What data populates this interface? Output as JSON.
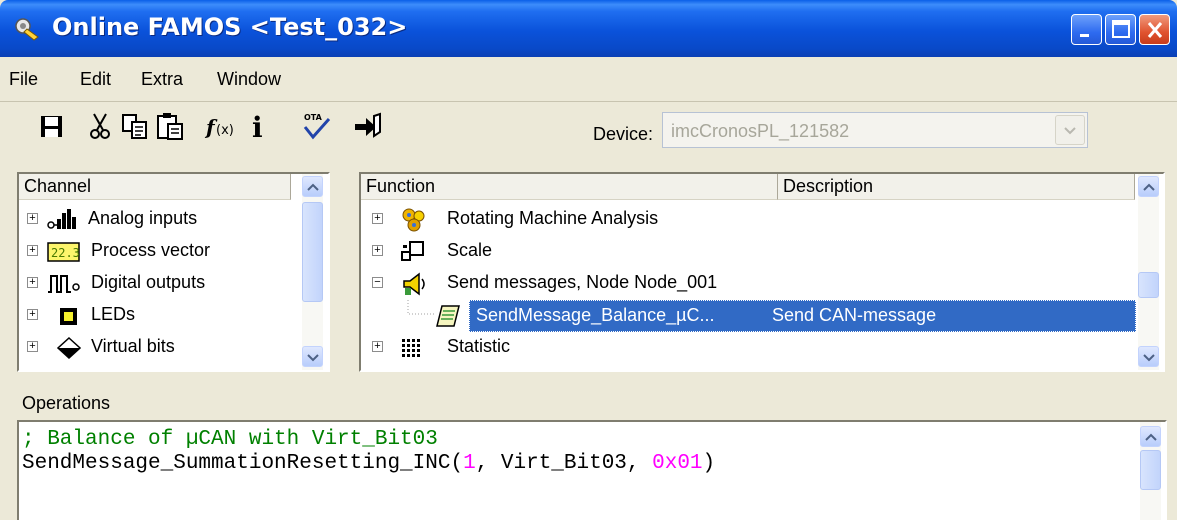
{
  "window": {
    "title": "Online FAMOS <Test_032>"
  },
  "menu": {
    "items": [
      {
        "label": "File"
      },
      {
        "label": "Edit"
      },
      {
        "label": "Extra"
      },
      {
        "label": "Window"
      }
    ]
  },
  "toolbar": {
    "tools": [
      "save-icon",
      "cut-icon",
      "copy-icon",
      "paste-icon",
      "function-icon",
      "info-icon",
      "check-ota-icon",
      "transfer-icon"
    ],
    "device_label": "Device:",
    "device_value": "imcCronosPL_121582"
  },
  "channel_panel": {
    "header": "Channel",
    "items": [
      {
        "label": "Analog inputs",
        "icon": "analog-inputs-icon"
      },
      {
        "label": "Process vector",
        "icon": "process-vector-icon"
      },
      {
        "label": "Digital outputs",
        "icon": "digital-outputs-icon"
      },
      {
        "label": "LEDs",
        "icon": "led-icon"
      },
      {
        "label": "Virtual bits",
        "icon": "virtual-bits-icon"
      }
    ]
  },
  "function_panel": {
    "columns": [
      "Function",
      "Description"
    ],
    "items": [
      {
        "label": "Rotating Machine Analysis",
        "description": "",
        "icon": "gears-icon"
      },
      {
        "label": "Scale",
        "description": "",
        "icon": "scale-icon"
      },
      {
        "label": "Send messages, Node Node_001",
        "description": "",
        "icon": "send-messages-icon"
      },
      {
        "label": "SendMessage_Balance_µC...",
        "description": "Send CAN-message",
        "icon": "message-icon"
      },
      {
        "label": "Statistic",
        "description": "",
        "icon": "statistic-icon"
      }
    ]
  },
  "operations": {
    "header": "Operations",
    "comment": "; Balance of µCAN with Virt_Bit03",
    "code": {
      "prefix": "SendMessage_SummationResetting_INC(",
      "arg1": "1",
      "middle": ", Virt_Bit03, ",
      "arg3": "0x01",
      "suffix": ")"
    }
  },
  "colors": {
    "titlebar": "#0a52da",
    "selection": "#316ac5",
    "comment": "#008000",
    "literal": "#ff00ff"
  }
}
